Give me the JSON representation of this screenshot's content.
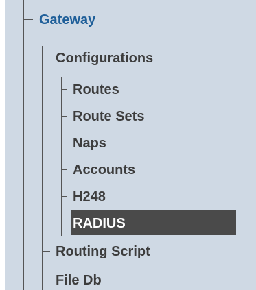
{
  "tree": {
    "gateway": {
      "label": "Gateway"
    },
    "configurations": {
      "label": "Configurations",
      "children": [
        {
          "label": "Routes"
        },
        {
          "label": "Route Sets"
        },
        {
          "label": "Naps"
        },
        {
          "label": "Accounts"
        },
        {
          "label": "H248"
        },
        {
          "label": "RADIUS",
          "selected": true
        }
      ]
    },
    "routing_script": {
      "label": "Routing Script"
    },
    "file_db": {
      "label": "File Db"
    }
  },
  "colors": {
    "panel_background": "#cfd9e4",
    "gateway_link": "#1f5f99",
    "selected_background": "#4a4a4a",
    "selected_text": "#ffffff",
    "tree_text": "#3d3d3d"
  }
}
